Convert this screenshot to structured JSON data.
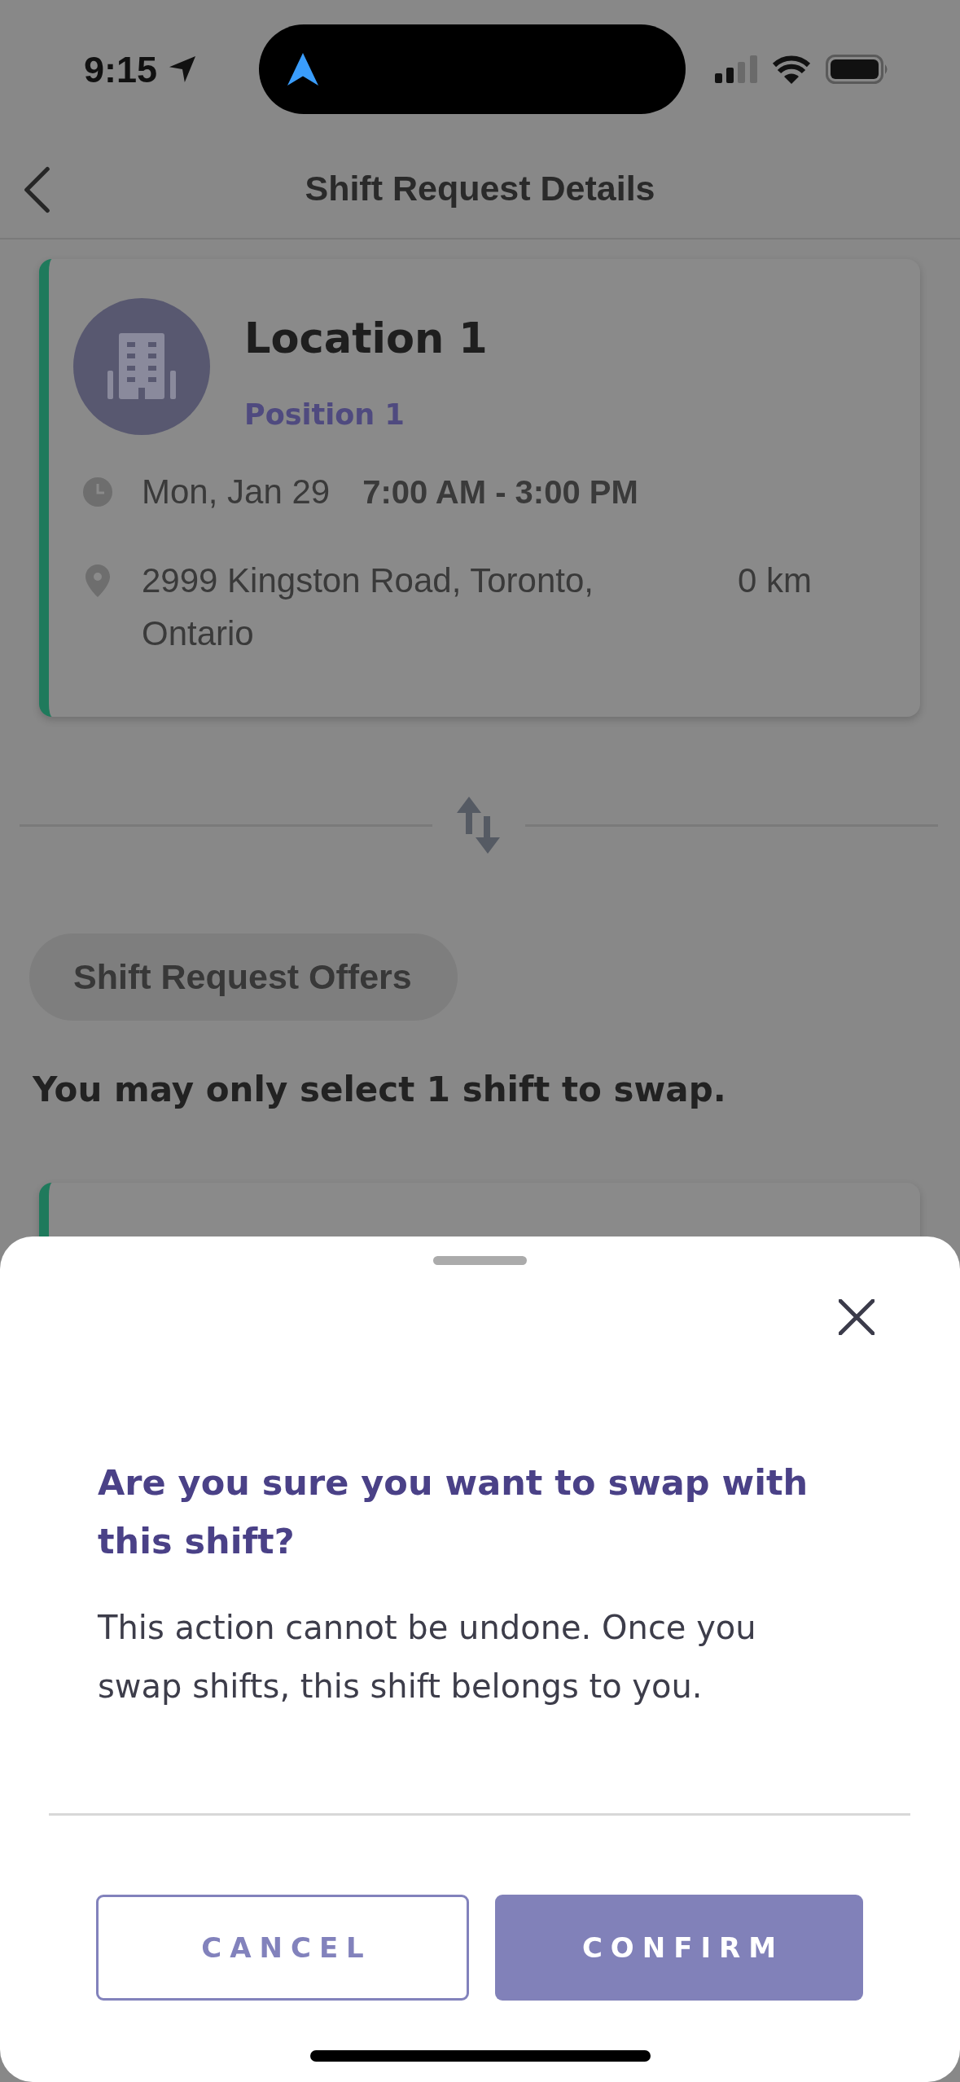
{
  "status_bar": {
    "time": "9:15"
  },
  "header": {
    "title": "Shift Request Details"
  },
  "shift_card": {
    "location": "Location 1",
    "position": "Position 1",
    "date": "Mon, Jan 29",
    "time_range": "7:00 AM - 3:00 PM",
    "address": "2999 Kingston Road, Toronto, Ontario",
    "distance": "0 km"
  },
  "offers": {
    "label": "Shift Request Offers",
    "instruction": "You may only select 1 shift to swap."
  },
  "dialog": {
    "title": "Are you sure you want to swap with this shift?",
    "message": "This action cannot be undone. Once you swap shifts, this shift belongs to you.",
    "buttons": [
      {
        "label": "CANCEL",
        "kind": "outline"
      },
      {
        "label": "CONFIRM",
        "kind": "filled"
      }
    ]
  }
}
